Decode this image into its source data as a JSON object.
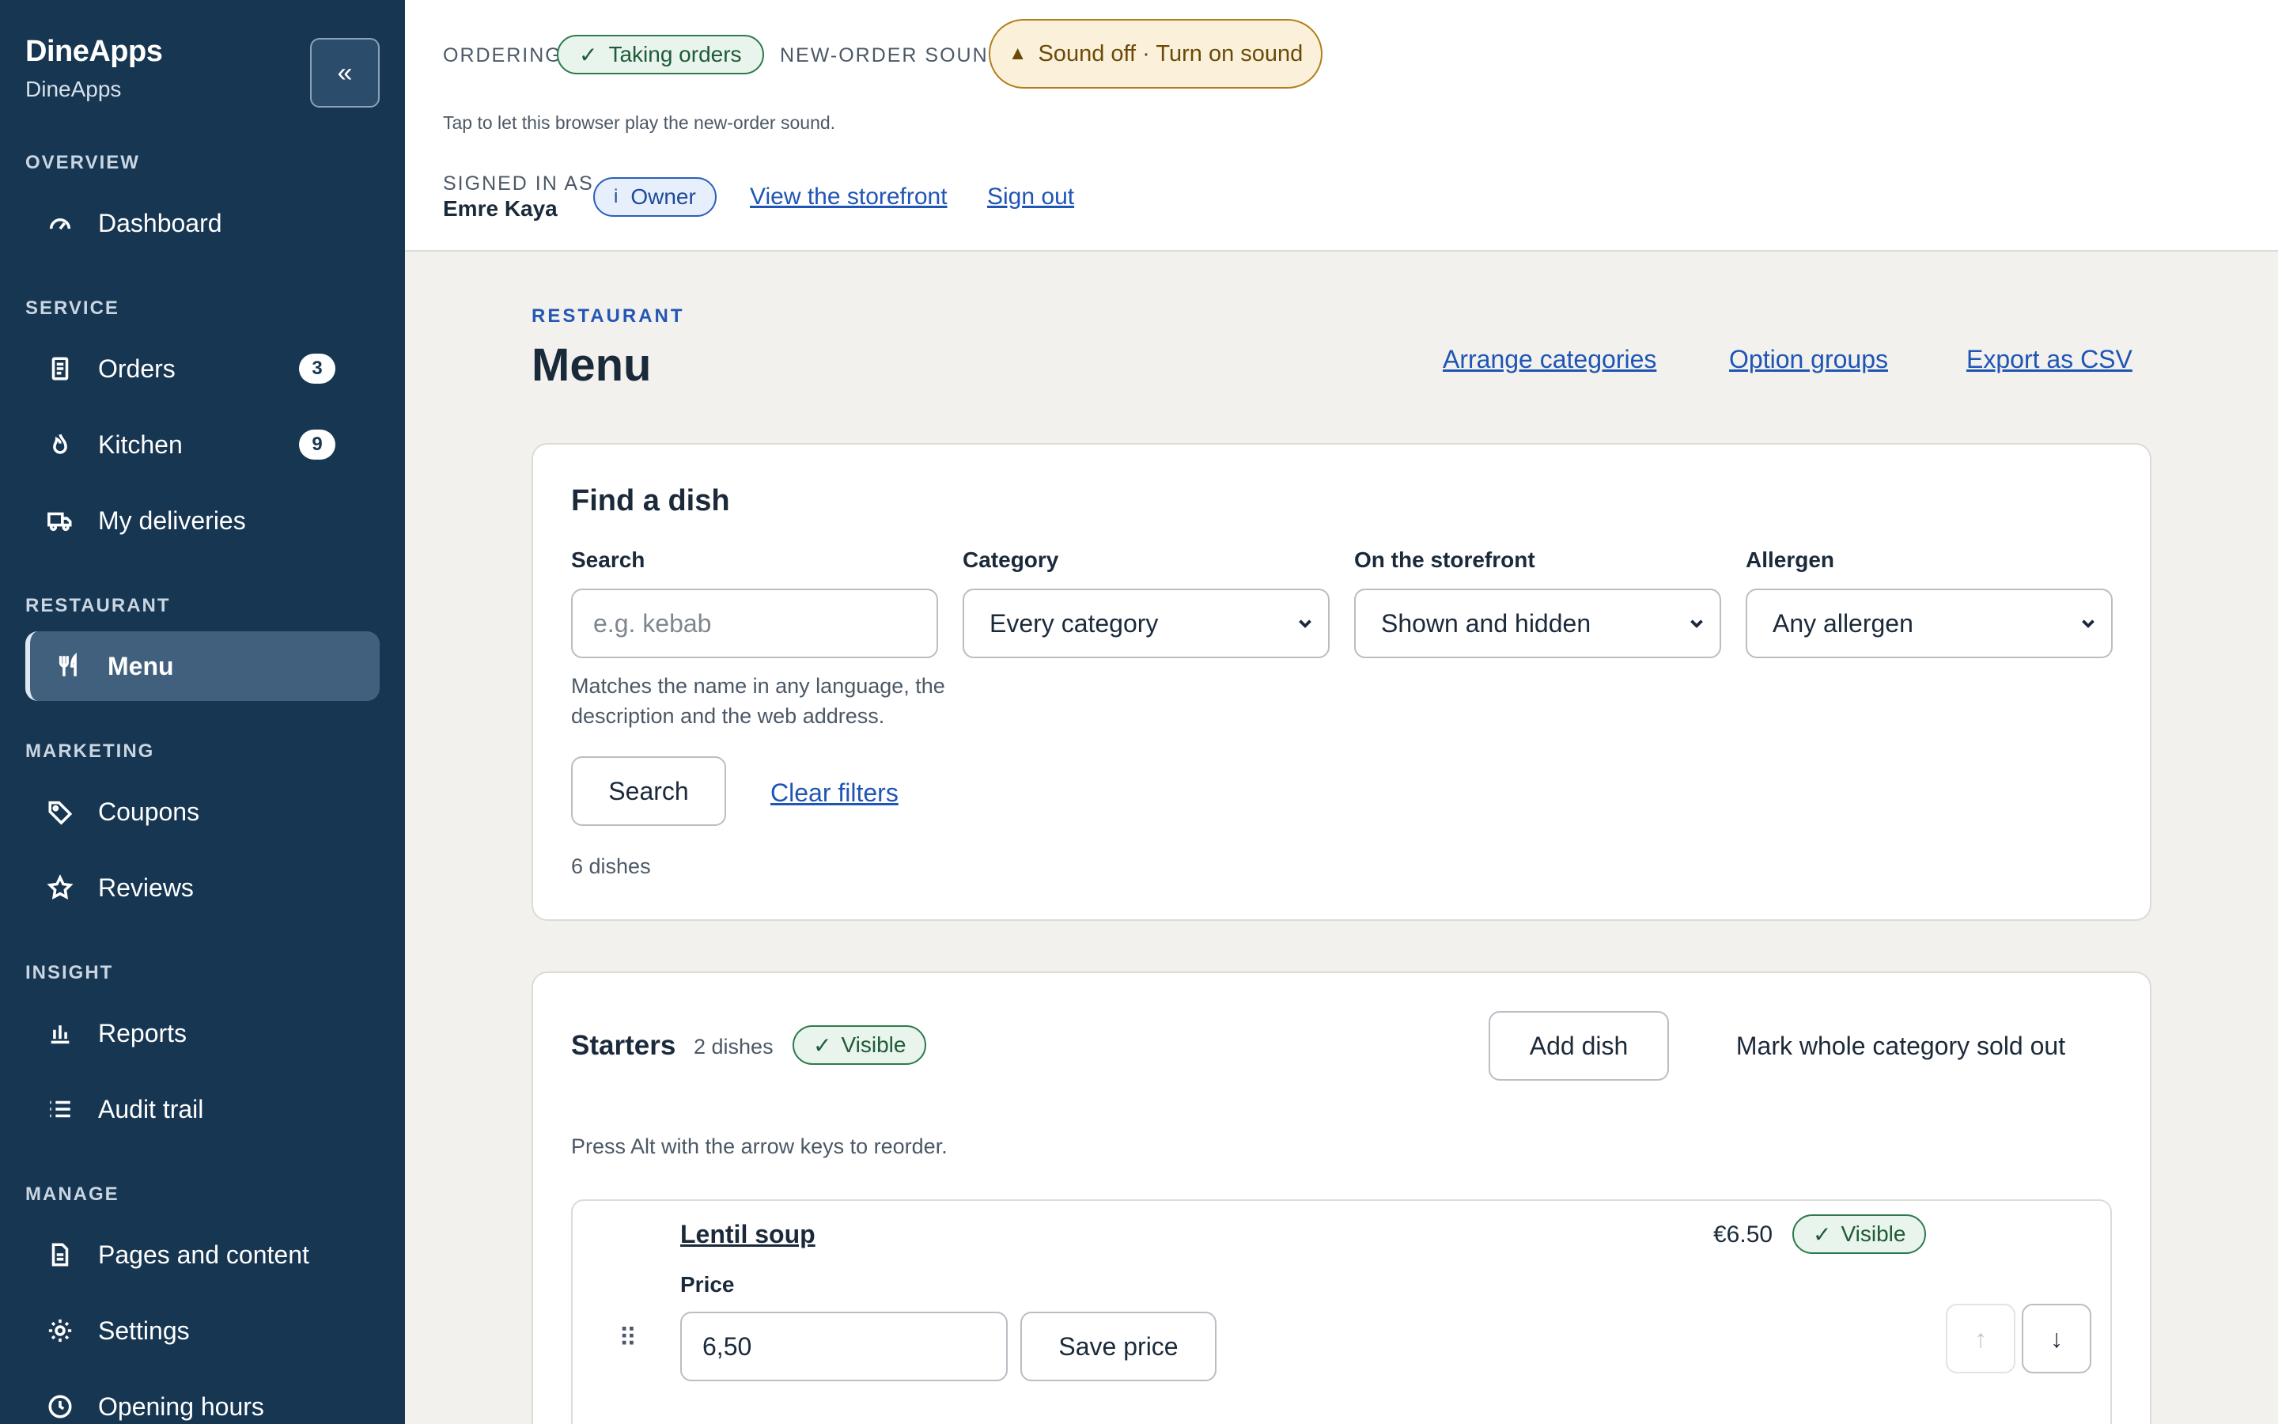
{
  "sidebar": {
    "brand": "DineApps",
    "brand_sub": "DineApps",
    "collapse_label": "«",
    "sections": {
      "overview": "OVERVIEW",
      "service": "SERVICE",
      "restaurant": "RESTAURANT",
      "marketing": "MARKETING",
      "insight": "INSIGHT",
      "manage": "MANAGE"
    },
    "items": {
      "dashboard": "Dashboard",
      "orders": "Orders",
      "orders_count": "3",
      "kitchen": "Kitchen",
      "kitchen_count": "9",
      "deliveries": "My deliveries",
      "menu": "Menu",
      "coupons": "Coupons",
      "reviews": "Reviews",
      "reports": "Reports",
      "audit": "Audit trail",
      "pages": "Pages and content",
      "settings": "Settings",
      "hours": "Opening hours"
    }
  },
  "topbar": {
    "ordering_label": "ORDERING",
    "ordering_status": "Taking orders",
    "sound_label": "NEW-ORDER SOUND",
    "sound_button": "Sound off · Turn on sound",
    "sound_hint": "Tap to let this browser play the new-order sound.",
    "signed_in_label": "SIGNED IN AS",
    "user_name": "Emre Kaya",
    "role": "Owner",
    "storefront_link": "View the storefront",
    "signout_link": "Sign out"
  },
  "page": {
    "eyebrow": "RESTAURANT",
    "title": "Menu",
    "links": {
      "arrange": "Arrange categories",
      "option_groups": "Option groups",
      "export": "Export as CSV"
    }
  },
  "filters": {
    "title": "Find a dish",
    "search_label": "Search",
    "search_placeholder": "e.g. kebab",
    "category_label": "Category",
    "category_value": "Every category",
    "storefront_label": "On the storefront",
    "storefront_value": "Shown and hidden",
    "allergen_label": "Allergen",
    "allergen_value": "Any allergen",
    "help": "Matches the name in any language, the description and the web address.",
    "search_button": "Search",
    "clear_link": "Clear filters",
    "result_count": "6 dishes"
  },
  "category": {
    "name": "Starters",
    "count": "2 dishes",
    "visibility": "Visible",
    "add_button": "Add dish",
    "sold_out_button": "Mark whole category sold out",
    "reorder_hint": "Press Alt with the arrow keys to reorder."
  },
  "dish": {
    "name": "Lentil soup",
    "price_display": "€6.50",
    "visibility": "Visible",
    "price_label": "Price",
    "price_value": "6,50",
    "save_button": "Save price",
    "up_arrow": "↑",
    "down_arrow": "↓"
  },
  "colors": {
    "sidebar_bg": "#173652",
    "accent_link": "#1f55b5",
    "success": "#2d7a4c",
    "warning": "#b07e1c",
    "page_bg": "#f2f1ed"
  }
}
